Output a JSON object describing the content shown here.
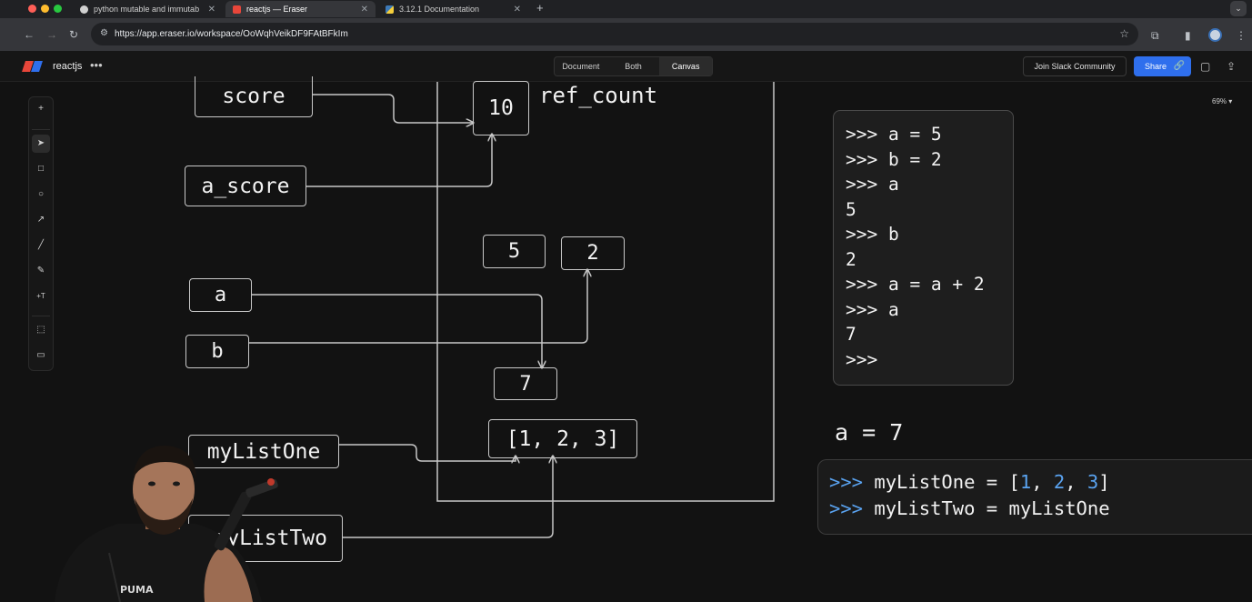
{
  "browser": {
    "tabs": [
      {
        "label": "python mutable and immutab",
        "active": false
      },
      {
        "label": "reactjs — Eraser",
        "active": true
      },
      {
        "label": "3.12.1 Documentation",
        "active": false
      }
    ],
    "url": "https://app.eraser.io/workspace/OoWqhVeikDF9FAtBFkIm"
  },
  "app": {
    "workspace_name": "reactjs",
    "view_tabs": [
      "Document",
      "Both",
      "Canvas"
    ],
    "selected_view": "Canvas",
    "join_slack_label": "Join Slack Community",
    "share_label": "Share",
    "zoom_label": "69% ▾",
    "brand_colors": {
      "red": "#e8463a",
      "blue": "#2f6fed"
    }
  },
  "toolbar": {
    "icons": [
      "plus-icon",
      "pointer-icon",
      "rectangle-icon",
      "ellipse-icon",
      "arrow-icon",
      "line-icon",
      "pen-icon",
      "text-icon",
      "frame-icon",
      "comment-icon"
    ]
  },
  "diagram": {
    "variables": {
      "score": "score",
      "a_score": "a_score",
      "a": "a",
      "b": "b",
      "myListOne": "myListOne",
      "myListTwo": "myListTwo"
    },
    "values": {
      "ten": "10",
      "five": "5",
      "two": "2",
      "seven": "7",
      "list": "[1, 2, 3]"
    },
    "ref_count_label": "ref_count",
    "note": "a = 7"
  },
  "repl_top": [
    ">>> a = 5",
    ">>> b = 2",
    ">>> a",
    "5",
    ">>> b",
    "2",
    ">>> a = a + 2",
    ">>> a",
    "7",
    ">>>"
  ],
  "repl_bottom": {
    "prompt": ">>>",
    "line1": {
      "name": "myListOne",
      "eq": " = [",
      "v1": "1",
      "sep1": ", ",
      "v2": "2",
      "sep2": ", ",
      "v3": "3",
      "close": "]"
    },
    "line2": {
      "text": "myListTwo = myListOne"
    }
  }
}
